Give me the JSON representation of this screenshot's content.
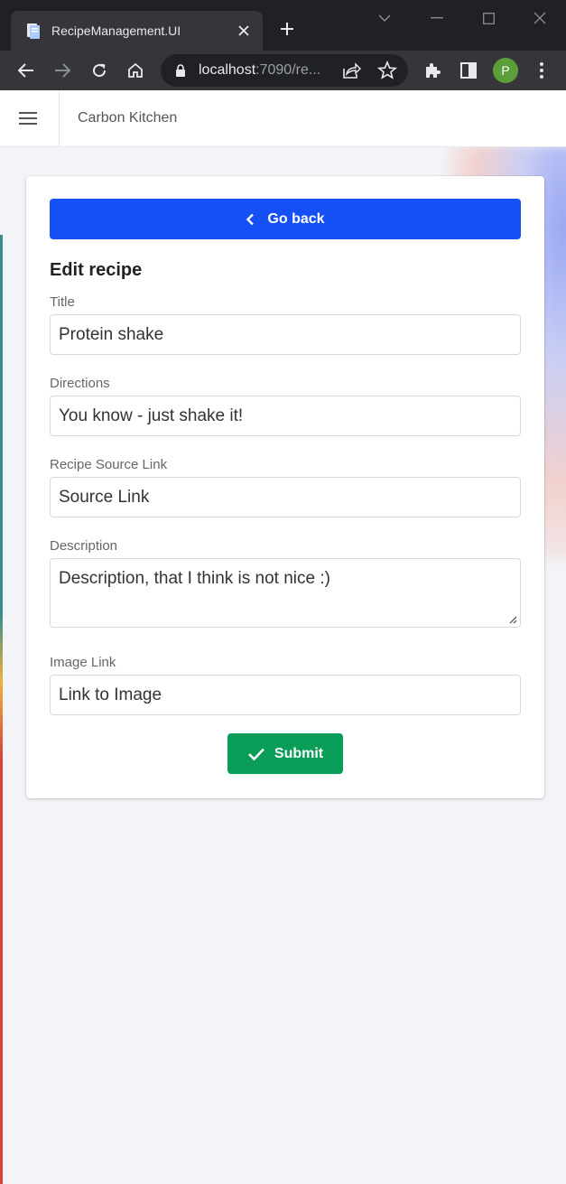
{
  "browser": {
    "tab_title": "RecipeManagement.UI",
    "url_host": "localhost",
    "url_rest": ":7090/re...",
    "profile_initial": "P"
  },
  "app": {
    "brand": "Carbon Kitchen"
  },
  "form": {
    "back_label": "Go back",
    "heading": "Edit recipe",
    "title_label": "Title",
    "title_value": "Protein shake",
    "directions_label": "Directions",
    "directions_value": "You know - just shake it!",
    "source_label": "Recipe Source Link",
    "source_value": "Source Link",
    "description_label": "Description",
    "description_value": "Description, that I think is not nice :)",
    "image_label": "Image Link",
    "image_value": "Link to Image",
    "submit_label": "Submit"
  },
  "colors": {
    "primary": "#1450f5",
    "success": "#0a9d58",
    "page_bg": "#f3f4f8"
  }
}
